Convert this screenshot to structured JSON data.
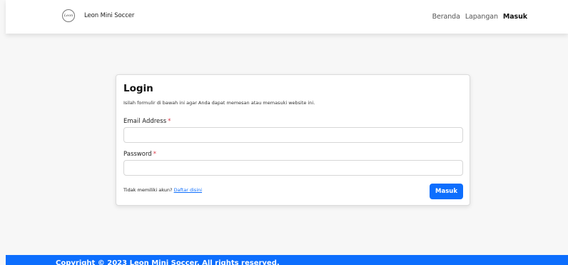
{
  "brand": {
    "name": "Leon Mini Soccer",
    "logo_text": "Leon"
  },
  "nav": {
    "items": [
      "Beranda",
      "Lapangan",
      "Masuk"
    ],
    "active": "Masuk"
  },
  "login": {
    "title": "Login",
    "subtitle": "Isilah formulir di bawah ini agar Anda dapat memesan atau memasuki website ini.",
    "email_label": "Email Address",
    "email_value": "",
    "password_label": "Password",
    "password_value": "",
    "required_mark": "*",
    "no_account_text": "Tidak memiliki akun?",
    "register_link": "Daftar disini",
    "submit_label": "Masuk"
  },
  "footer": {
    "text": "Copyright © 2023 Leon Mini Soccer. All rights reserved."
  },
  "colors": {
    "primary": "#0d6efd",
    "required": "#dc3545",
    "background": "#f7f7f7"
  }
}
